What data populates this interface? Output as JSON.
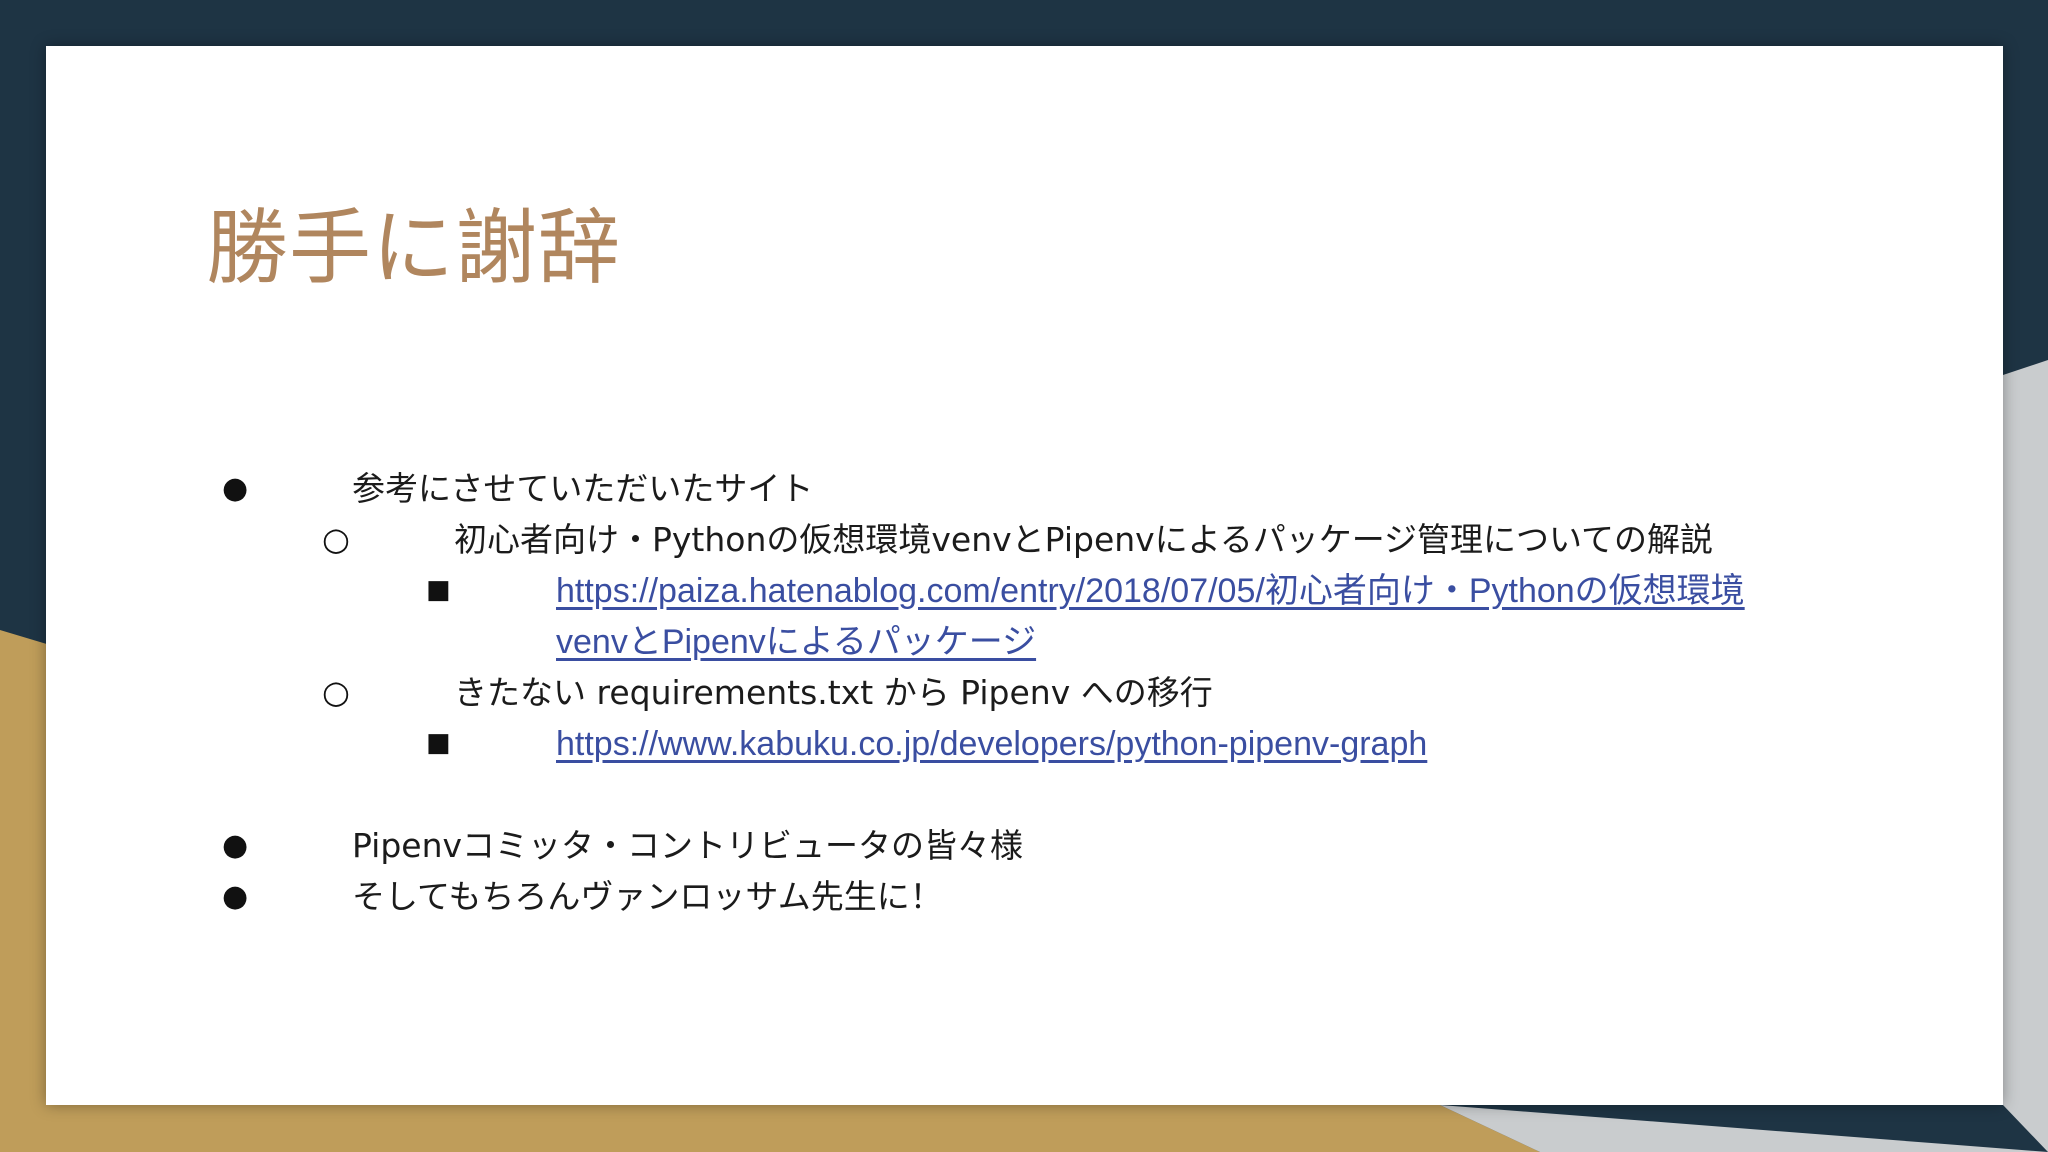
{
  "slide": {
    "title": "勝手に謝辞",
    "bullets": {
      "b1": "参考にさせていただいたサイト",
      "b1_1": "初心者向け・Pythonの仮想環境venvとPipenvによるパッケージ管理についての解説",
      "b1_1_link_line1": "https://paiza.hatenablog.com/entry/2018/07/05/初心者向け・Pythonの仮想環境",
      "b1_1_link_line2": "venvとPipenvによるパッケージ",
      "b1_2": "きたない requirements.txt から Pipenv への移行",
      "b1_2_link": "https://www.kabuku.co.jp/developers/python-pipenv-graph",
      "b2": "Pipenvコミッタ・コントリビュータの皆々様",
      "b3": "そしてもちろんヴァンロッサム先生に！"
    },
    "bullet_glyphs": {
      "level1": "●",
      "level2": "○",
      "level3": "■"
    }
  },
  "colors": {
    "background_dark": "#1e3444",
    "background_gold": "#bf9d5a",
    "title": "#b0865e",
    "link": "#3a4ea1"
  }
}
